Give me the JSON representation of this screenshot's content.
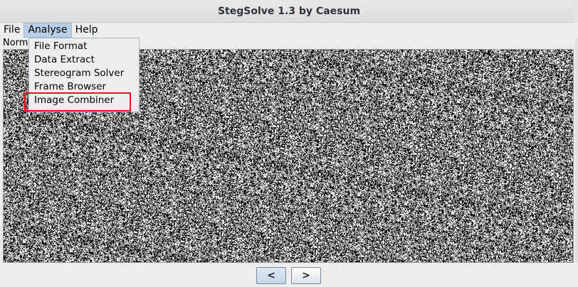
{
  "window": {
    "title": "StegSolve 1.3 by Caesum"
  },
  "menubar": {
    "file": "File",
    "analyse": "Analyse",
    "help": "Help"
  },
  "analyse_menu": {
    "items": [
      "File Format",
      "Data Extract",
      "Stereogram Solver",
      "Frame Browser",
      "Image Combiner"
    ],
    "highlighted_item": "Image Combiner"
  },
  "image_panel": {
    "mode_label": "Norm"
  },
  "navigation": {
    "prev_label": "<",
    "next_label": ">"
  },
  "colors": {
    "annotation_box": "#e8141c",
    "menu_highlight": "#b8cfe5"
  }
}
